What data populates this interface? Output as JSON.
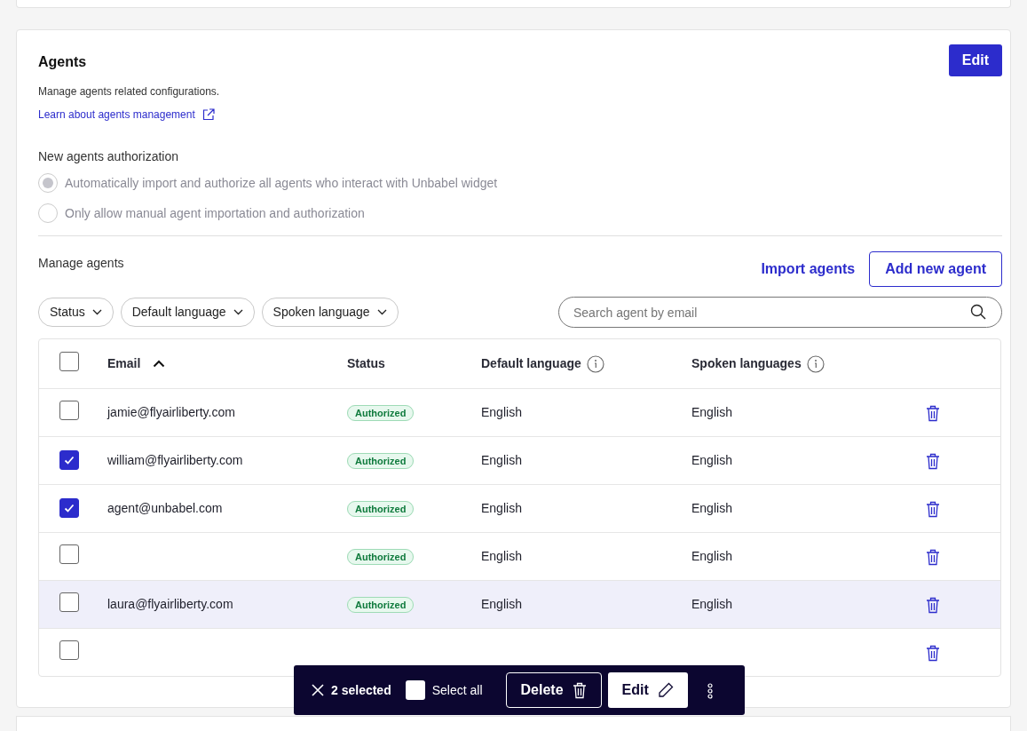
{
  "section": {
    "title": "Agents",
    "edit_button": "Edit",
    "description": "Manage agents related configurations.",
    "link": "Learn about agents management"
  },
  "authorization": {
    "title": "New agents authorization",
    "disabled": true,
    "options": [
      {
        "label": "Automatically import and authorize all agents who interact with Unbabel widget",
        "selected": true
      },
      {
        "label": "Only allow manual agent importation and authorization",
        "selected": false
      }
    ]
  },
  "manage": {
    "title": "Manage agents",
    "import_button": "Import agents",
    "add_button": "Add new agent",
    "filters": [
      "Status",
      "Default language",
      "Spoken language"
    ],
    "search": {
      "placeholder": "Search agent by email"
    }
  },
  "table": {
    "select_all_checked": false,
    "columns": [
      {
        "label": "Email",
        "sorted": true,
        "info": false
      },
      {
        "label": "Status",
        "sorted": false,
        "info": false
      },
      {
        "label": "Default language",
        "sorted": false,
        "info": true
      },
      {
        "label": "Spoken languages",
        "sorted": false,
        "info": true
      }
    ],
    "rows": [
      {
        "checked": false,
        "highlighted": false,
        "email": "jamie@flyairliberty.com",
        "status": "Authorized",
        "default_language": "English",
        "spoken_languages": "English"
      },
      {
        "checked": true,
        "highlighted": false,
        "email": "william@flyairliberty.com",
        "status": "Authorized",
        "default_language": "English",
        "spoken_languages": "English"
      },
      {
        "checked": true,
        "highlighted": false,
        "email": "agent@unbabel.com",
        "status": "Authorized",
        "default_language": "English",
        "spoken_languages": "English"
      },
      {
        "checked": false,
        "highlighted": false,
        "status": "Authorized",
        "default_language": "English",
        "spoken_languages": "English"
      },
      {
        "checked": false,
        "highlighted": true,
        "email": "laura@flyairliberty.com",
        "status": "Authorized",
        "default_language": "English",
        "spoken_languages": "English"
      },
      {
        "checked": false,
        "highlighted": false
      }
    ]
  },
  "action_bar": {
    "count": "2 selected",
    "select_all": "Select all",
    "select_all_checked": false,
    "delete": "Delete",
    "edit": "Edit"
  }
}
